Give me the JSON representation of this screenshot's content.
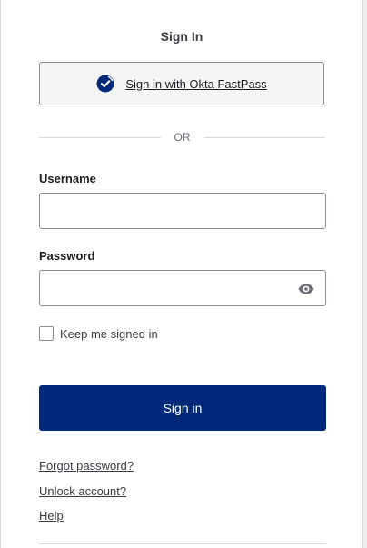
{
  "title": "Sign In",
  "fastpass": {
    "label": "Sign in with Okta FastPass",
    "icon": "okta-fastpass-check-icon",
    "accent_color": "#00297a"
  },
  "divider": {
    "label": "OR"
  },
  "username": {
    "label": "Username",
    "value": "",
    "placeholder": ""
  },
  "password": {
    "label": "Password",
    "value": "",
    "placeholder": "",
    "toggle_icon": "eye-icon"
  },
  "remember": {
    "label": "Keep me signed in",
    "checked": false
  },
  "submit": {
    "label": "Sign in",
    "color": "#00297a"
  },
  "links": {
    "forgot": "Forgot password?",
    "unlock": "Unlock account?",
    "help": "Help"
  }
}
